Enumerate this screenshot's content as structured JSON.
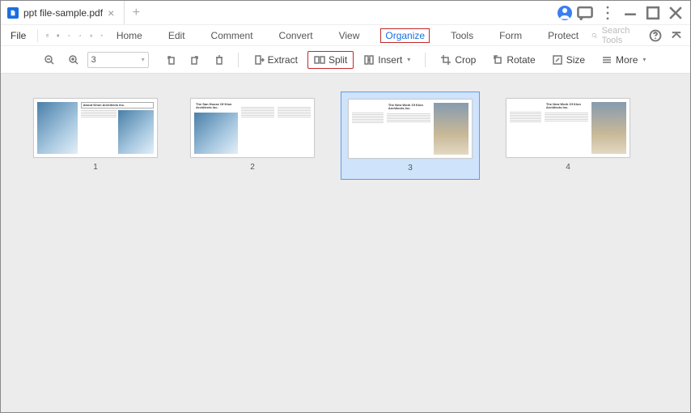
{
  "tab": {
    "title": "ppt file-sample.pdf"
  },
  "file_menu": "File",
  "main_menu": {
    "home": "Home",
    "edit": "Edit",
    "comment": "Comment",
    "convert": "Convert",
    "view": "View",
    "organize": "Organize",
    "tools": "Tools",
    "form": "Form",
    "protect": "Protect"
  },
  "search": {
    "placeholder": "Search Tools"
  },
  "toolbar": {
    "page_value": "3",
    "extract": "Extract",
    "split": "Split",
    "insert": "Insert",
    "crop": "Crop",
    "rotate": "Rotate",
    "size": "Size",
    "more": "More"
  },
  "thumbs": {
    "p1": {
      "num": "1",
      "title": "About Khon\nArchitects Inc."
    },
    "p2": {
      "num": "2",
      "title": "The San House Of\nKlon Architects Inc."
    },
    "p3": {
      "num": "3",
      "title": "The New Work Of\nKlon Architects Inc."
    },
    "p4": {
      "num": "4",
      "title": "The New Work Of\nKlon Architects Inc."
    }
  }
}
